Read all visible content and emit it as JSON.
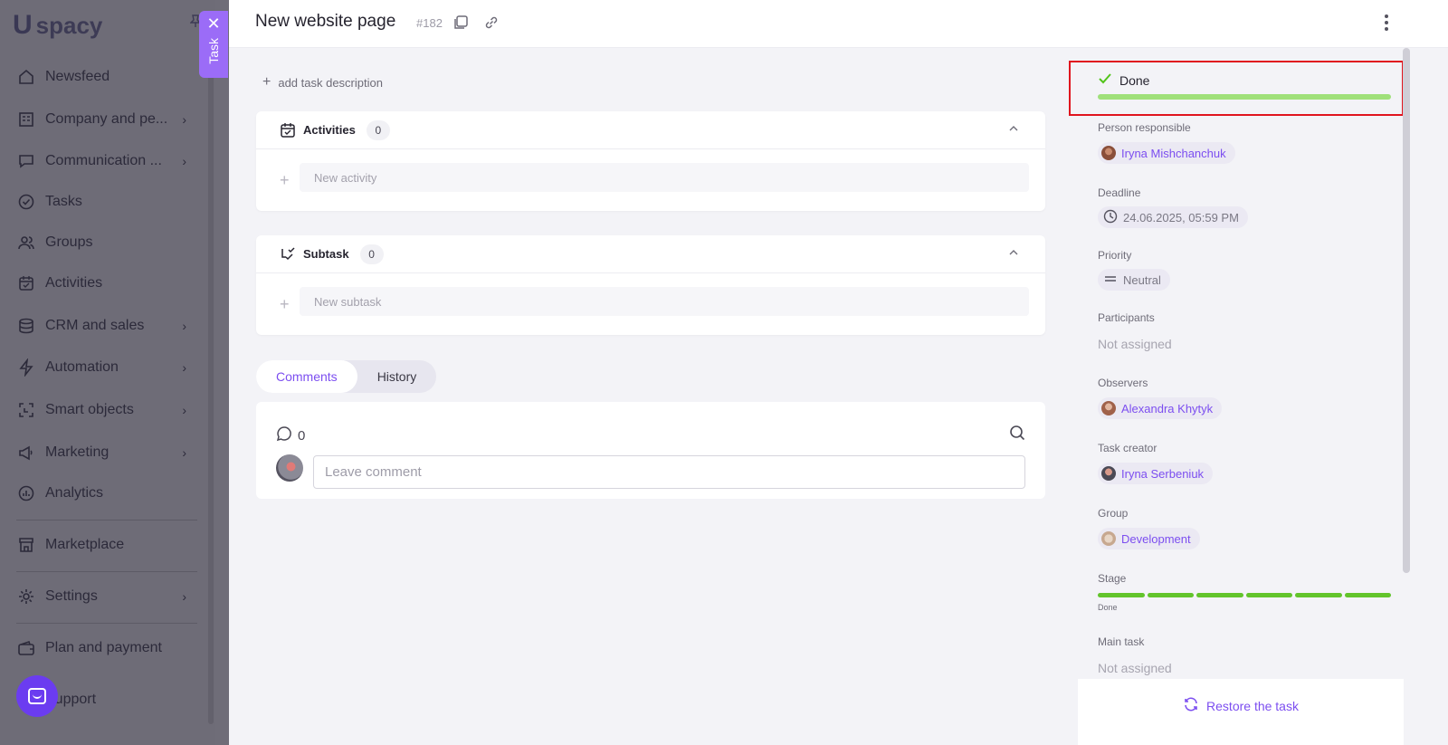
{
  "sidebar": {
    "logo": "spacy",
    "items": [
      {
        "label": "Newsfeed",
        "icon": "home-icon",
        "chevron": false
      },
      {
        "label": "Company and pe...",
        "icon": "building-icon",
        "chevron": true
      },
      {
        "label": "Communication ...",
        "icon": "chat-icon",
        "chevron": true
      },
      {
        "label": "Tasks",
        "icon": "check-circle-icon",
        "chevron": false
      },
      {
        "label": "Groups",
        "icon": "users-icon",
        "chevron": false
      },
      {
        "label": "Activities",
        "icon": "calendar-icon",
        "chevron": false
      },
      {
        "label": "CRM and sales",
        "icon": "database-icon",
        "chevron": true
      },
      {
        "label": "Automation",
        "icon": "lightning-icon",
        "chevron": true
      },
      {
        "label": "Smart objects",
        "icon": "scan-icon",
        "chevron": true
      },
      {
        "label": "Marketing",
        "icon": "megaphone-icon",
        "chevron": true
      },
      {
        "label": "Analytics",
        "icon": "chart-icon",
        "chevron": false
      },
      {
        "label": "Marketplace",
        "icon": "store-icon",
        "chevron": false
      },
      {
        "label": "Settings",
        "icon": "gear-icon",
        "chevron": true
      },
      {
        "label": "Plan and payment",
        "icon": "wallet-icon",
        "chevron": false
      },
      {
        "label": "Support",
        "icon": "support-icon",
        "chevron": false
      }
    ]
  },
  "task_tab": {
    "label": "Task",
    "close": "✕"
  },
  "header": {
    "title": "New website page",
    "task_number": "#182"
  },
  "main": {
    "add_description": "add task description",
    "activities": {
      "label": "Activities",
      "count": "0",
      "placeholder": "New activity"
    },
    "subtask": {
      "label": "Subtask",
      "count": "0",
      "placeholder": "New subtask"
    },
    "tabs": [
      {
        "label": "Comments",
        "active": true
      },
      {
        "label": "History",
        "active": false
      }
    ],
    "comments": {
      "count": "0",
      "placeholder": "Leave comment"
    }
  },
  "details": {
    "status": {
      "label": "Done",
      "progress": 1.0,
      "color": "#9fe07a"
    },
    "person_responsible": {
      "label": "Person responsible",
      "value": "Iryna Mishchanchuk"
    },
    "deadline": {
      "label": "Deadline",
      "value": "24.06.2025, 05:59 PM"
    },
    "priority": {
      "label": "Priority",
      "value": "Neutral"
    },
    "participants": {
      "label": "Participants",
      "value": "Not assigned"
    },
    "observers": {
      "label": "Observers",
      "value": "Alexandra Khytyk"
    },
    "task_creator": {
      "label": "Task creator",
      "value": "Iryna Serbeniuk"
    },
    "group": {
      "label": "Group",
      "value": "Development"
    },
    "stage": {
      "label": "Stage",
      "caption": "Done",
      "segments": 6,
      "completed": 6,
      "color": "#62c42b"
    },
    "main_task": {
      "label": "Main task",
      "value": "Not assigned"
    },
    "restore": "Restore the task"
  },
  "colors": {
    "accent": "#7c4ef0",
    "highlight_box": "#e0141e"
  }
}
